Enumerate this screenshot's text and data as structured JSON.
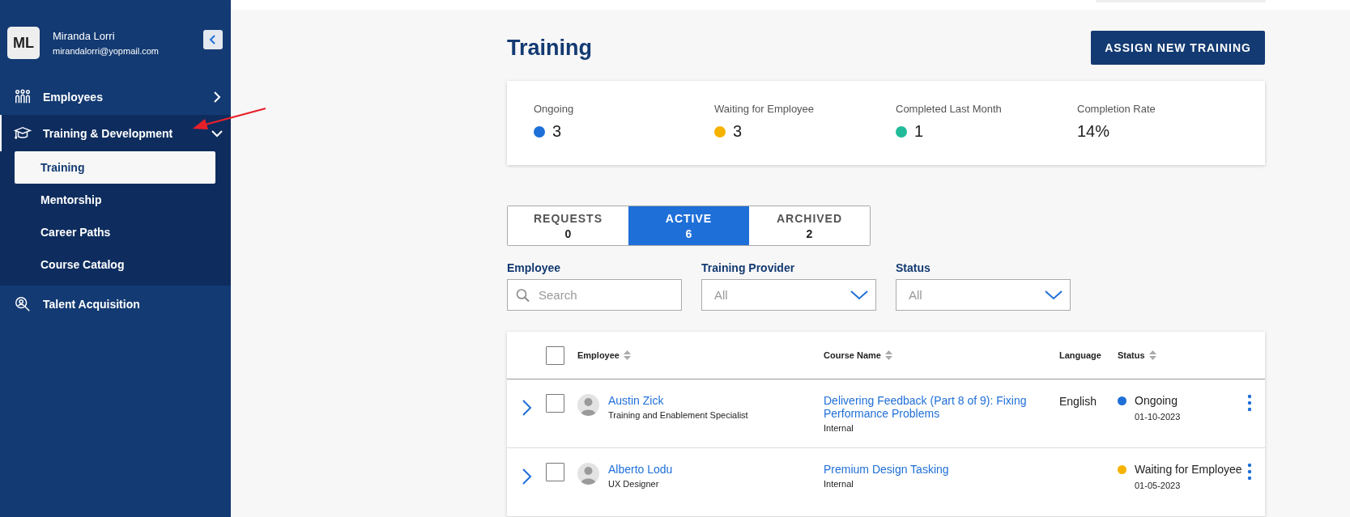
{
  "user": {
    "initials": "ML",
    "name": "Miranda Lorri",
    "email": "mirandalorri@yopmail.com"
  },
  "nav": [
    {
      "label": "Employees",
      "expanded": false
    },
    {
      "label": "Training & Development",
      "expanded": true,
      "children": [
        {
          "label": "Training",
          "selected": true
        },
        {
          "label": "Mentorship",
          "selected": false
        },
        {
          "label": "Career Paths",
          "selected": false
        },
        {
          "label": "Course Catalog",
          "selected": false
        }
      ]
    },
    {
      "label": "Talent Acquisition"
    }
  ],
  "page": {
    "title": "Training",
    "action": "ASSIGN NEW TRAINING"
  },
  "stats": [
    {
      "label": "Ongoing",
      "value": "3",
      "color": "#1f6fd8"
    },
    {
      "label": "Waiting for Employee",
      "value": "3",
      "color": "#f5b300"
    },
    {
      "label": "Completed Last Month",
      "value": "1",
      "color": "#22bb99"
    },
    {
      "label": "Completion Rate",
      "value": "14%"
    }
  ],
  "tabs": [
    {
      "label": "REQUESTS",
      "count": "0",
      "selected": false
    },
    {
      "label": "ACTIVE",
      "count": "6",
      "selected": true
    },
    {
      "label": "ARCHIVED",
      "count": "2",
      "selected": false
    }
  ],
  "filters": [
    {
      "kind": "search",
      "label": "Employee",
      "placeholder": "Search"
    },
    {
      "kind": "select",
      "label": "Training Provider",
      "placeholder": "All"
    },
    {
      "kind": "select",
      "label": "Status",
      "placeholder": "All"
    }
  ],
  "table": {
    "all_checked": false,
    "columns": [
      {
        "label": "Employee",
        "sortable": true
      },
      {
        "label": "Course Name",
        "sortable": true
      },
      {
        "label": "Language",
        "sortable": false
      },
      {
        "label": "Status",
        "sortable": true
      }
    ],
    "rows": [
      {
        "employee": "Austin Zick",
        "role": "Training and Enablement Specialist",
        "course": "Delivering Feedback (Part 8 of 9): Fixing Performance Problems",
        "provider": "Internal",
        "language": "English",
        "status": "Ongoing",
        "color": "#1f6fd8",
        "date": "01-10-2023",
        "checked": false
      },
      {
        "employee": "Alberto Lodu",
        "role": "UX Designer",
        "course": "Premium Design Tasking",
        "provider": "Internal",
        "status": "Waiting for Employee",
        "color": "#f5b300",
        "date": "01-05-2023",
        "checked": false
      }
    ]
  }
}
